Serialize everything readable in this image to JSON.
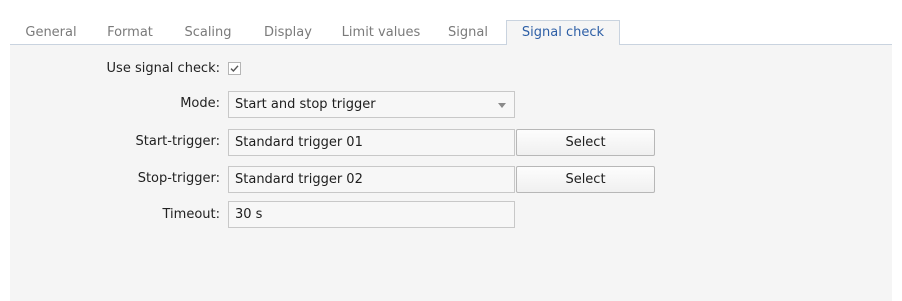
{
  "tabs": [
    {
      "label": "General",
      "active": false
    },
    {
      "label": "Format",
      "active": false
    },
    {
      "label": "Scaling",
      "active": false
    },
    {
      "label": "Display",
      "active": false
    },
    {
      "label": "Limit values",
      "active": false
    },
    {
      "label": "Signal",
      "active": false
    },
    {
      "label": "Signal check",
      "active": true
    }
  ],
  "form": {
    "use_signal_check": {
      "label": "Use signal check:",
      "checked": true
    },
    "mode": {
      "label": "Mode:",
      "value": "Start and stop trigger",
      "icon": "chevron-down-icon"
    },
    "start_trigger": {
      "label": "Start-trigger:",
      "value": "Standard trigger 01",
      "button_label": "Select"
    },
    "stop_trigger": {
      "label": "Stop-trigger:",
      "value": "Standard trigger 02",
      "button_label": "Select"
    },
    "timeout": {
      "label": "Timeout:",
      "value": "30 s"
    }
  },
  "colors": {
    "active_tab_text": "#2e5fa6",
    "inactive_tab_text": "#7a7a7a",
    "panel_bg": "#f5f5f5",
    "field_border": "#c8c8c8"
  }
}
